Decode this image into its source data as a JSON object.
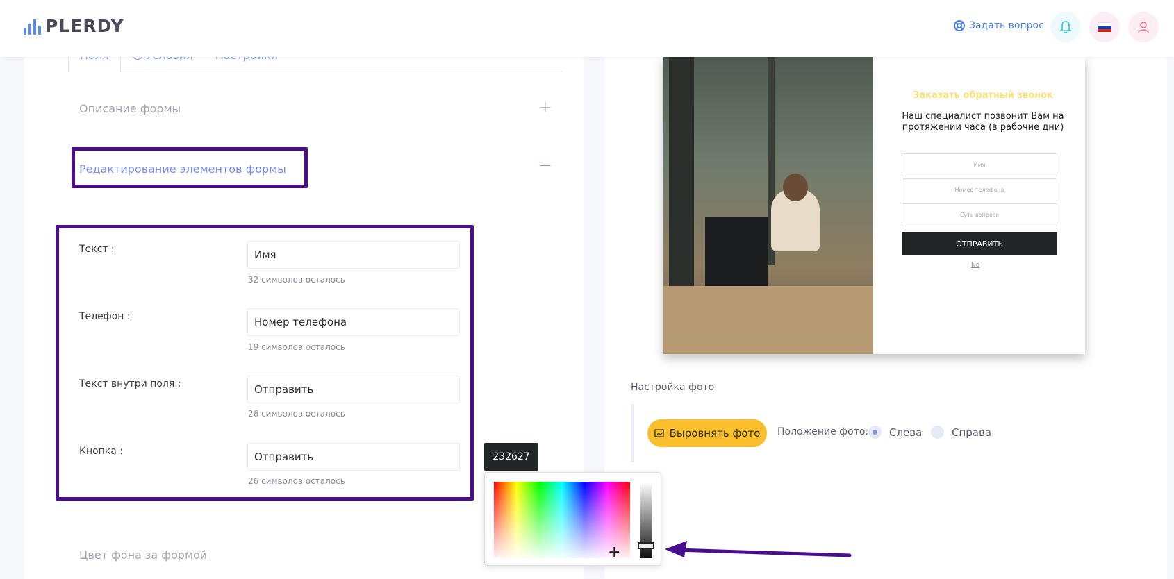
{
  "header": {
    "logo_text": "PLERDY",
    "ask_label": "Задать вопрос"
  },
  "tabs": [
    {
      "label": "Поля"
    },
    {
      "label": "Условия"
    },
    {
      "label": "Настройки"
    }
  ],
  "sections": {
    "form_description": "Описание формы",
    "edit_elements": "Редактирование элементов формы",
    "bg_color": "Цвет фона за формой"
  },
  "fields": [
    {
      "label": "Текст :",
      "value": "Имя",
      "hint": "32 символов осталось"
    },
    {
      "label": "Телефон :",
      "value": " Номер телефона",
      "hint": "19 символов осталось"
    },
    {
      "label": "Текст внутри поля :",
      "value": "Отправить",
      "hint": "26 символов осталось"
    },
    {
      "label": "Кнопка :",
      "value": "Отправить",
      "hint": "26 символов осталось"
    }
  ],
  "preview": {
    "title": "Заказать обратный звонок",
    "subtitle": "Наш специалист позвонит Вам на протяжении часа (в рабочие дни)",
    "inputs": [
      "Имя",
      "Номер телефона",
      "Суть вопроса"
    ],
    "button": "ОТПРАВИТЬ",
    "no_link": "No"
  },
  "photo_settings": {
    "title": "Настройка фото",
    "align_button": "Выровнять фото",
    "position_label": "Положение фото:",
    "left_label": "Слева",
    "right_label": "Справа",
    "selected": "left"
  },
  "color_picker": {
    "hex_value": "232627"
  },
  "colors": {
    "accent": "#4a0d8c",
    "link": "#7a9cf0",
    "button_yellow": "#f9bf2c",
    "dark": "#232627"
  }
}
